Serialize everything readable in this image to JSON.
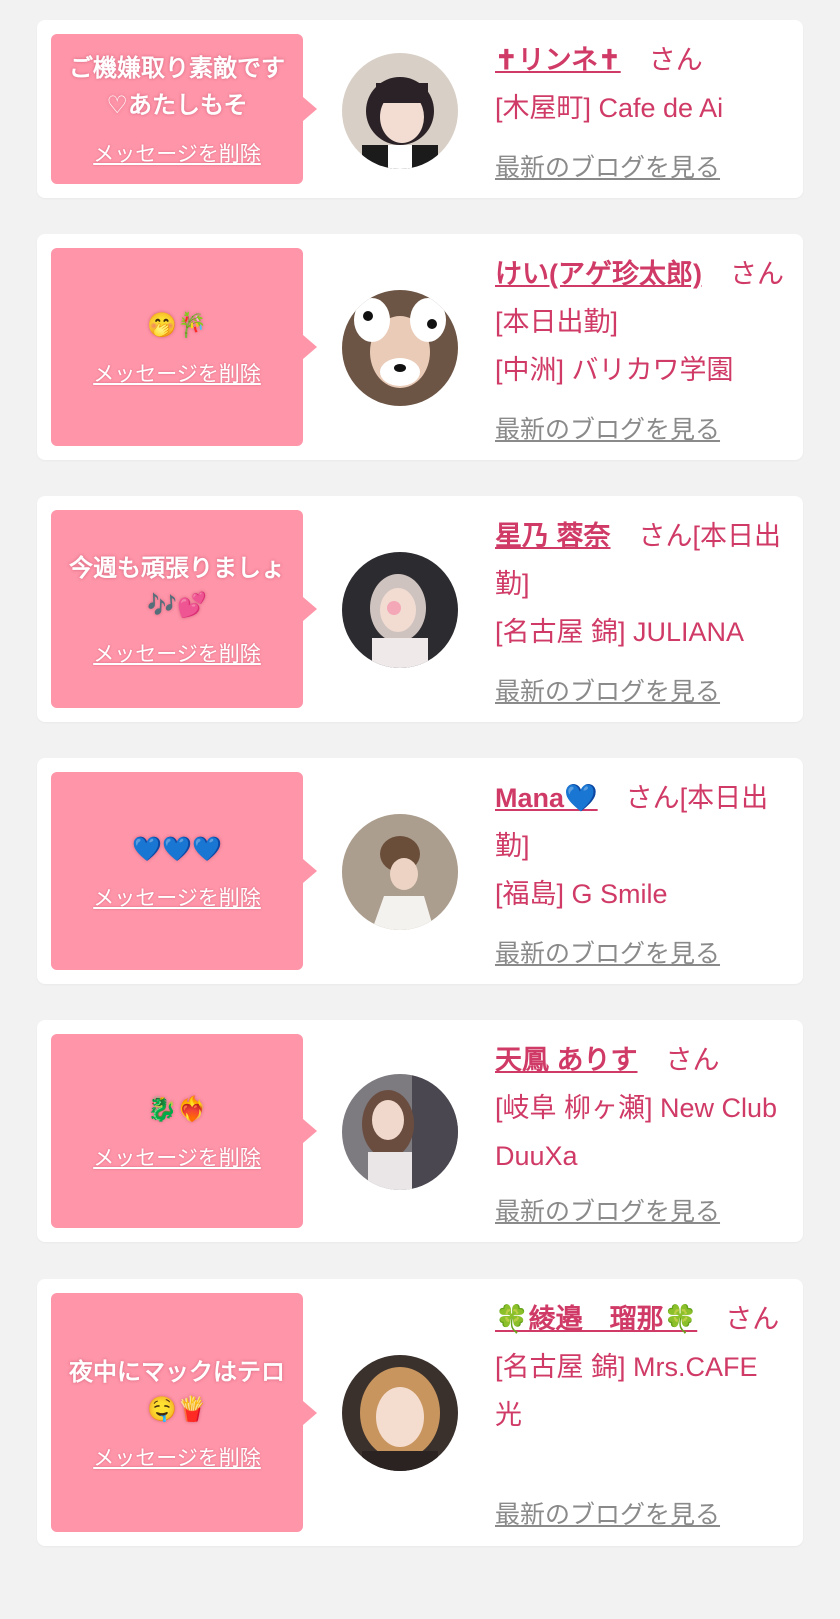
{
  "delete_label": "メッセージを削除",
  "blog_label": "最新のブログを見る",
  "honorific": "さん",
  "colors": {
    "bubble": "#ff95a9",
    "name": "#d03a66",
    "link_gray": "#8a8a8a",
    "page_bg": "#f2f2f2",
    "card_bg": "#ffffff"
  },
  "items": [
    {
      "message": "ご機嫌取り素敵です♡あたしもそ",
      "name": "✝︎リンネ✝︎",
      "status": "",
      "shop": "[木屋町] Cafe de Ai"
    },
    {
      "message": "🤭🎋",
      "name": "けい(アゲ珍太郎)",
      "status": "[本日出勤]",
      "shop": "[中洲] バリカワ学園"
    },
    {
      "message": "今週も頑張りましょ 🎶💕",
      "name": "星乃 蓉奈",
      "status": "[本日出勤]",
      "shop": "[名古屋 錦] JULIANA"
    },
    {
      "message": "💙💙💙",
      "name": "Mana💙",
      "status": "[本日出勤]",
      "shop": "[福島] G Smile"
    },
    {
      "message": "🐉❤️‍🔥",
      "name": "天鳳 ありす",
      "status": "",
      "shop": "[岐阜 柳ヶ瀬] New Club DuuXa"
    },
    {
      "message": "夜中にマックはテロ🤤🍟",
      "name": "🍀綾邉　瑠那🍀",
      "status": "",
      "shop": "[名古屋 錦] Mrs.CAFE 光"
    }
  ]
}
